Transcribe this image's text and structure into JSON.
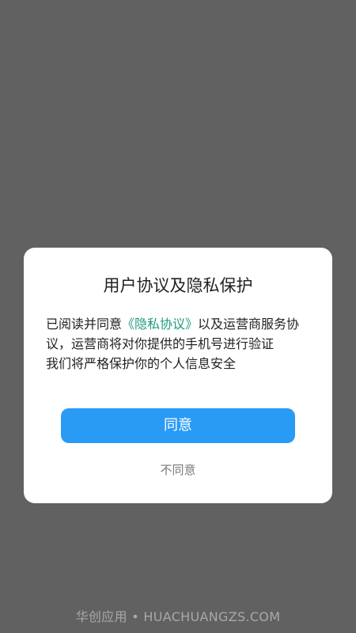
{
  "dialog": {
    "title": "用户协议及隐私保护",
    "body_prefix": "已阅读并同意",
    "privacy_link": "《隐私协议》",
    "body_after_link": "以及运营商服务协议，运营商将对你提供的手机号进行验证",
    "body_line2": "我们将严格保护你的个人信息安全",
    "agree_label": "同意",
    "disagree_label": "不同意"
  },
  "watermark": {
    "text": "华创应用 • HUACHUANGZS.COM"
  },
  "colors": {
    "overlay": "#616161",
    "primary_button": "#2a9bf5",
    "link": "#1f9b7c"
  }
}
